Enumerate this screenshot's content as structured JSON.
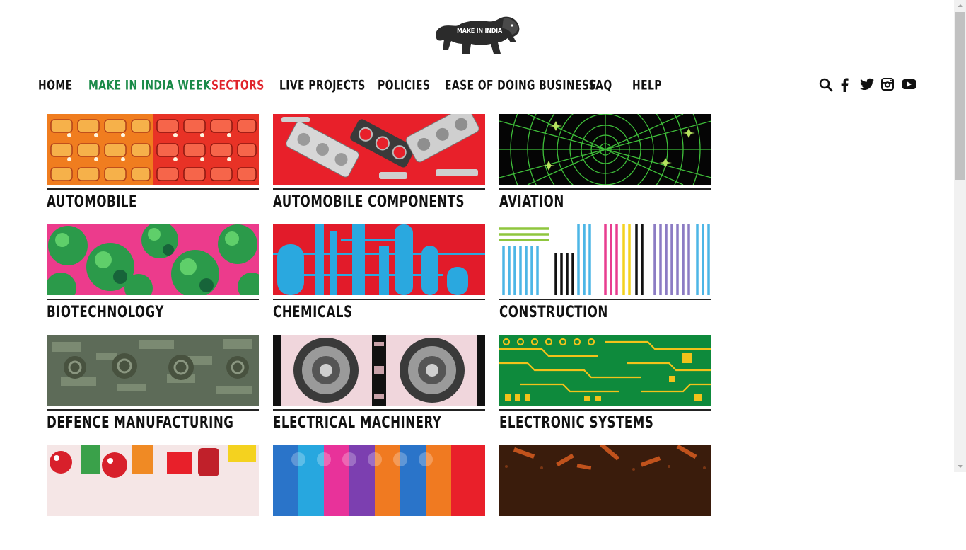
{
  "brand": {
    "logo_text": "MAKE IN INDIA",
    "colors": {
      "text": "#111111",
      "green": "#1a8a48",
      "red": "#e0242b"
    }
  },
  "nav": {
    "items": [
      {
        "label": "HOME",
        "state": "default"
      },
      {
        "label": "MAKE IN INDIA WEEK",
        "state": "highlight-green"
      },
      {
        "label": "SECTORS",
        "state": "active-red"
      },
      {
        "label": "LIVE PROJECTS",
        "state": "default"
      },
      {
        "label": "POLICIES",
        "state": "default"
      },
      {
        "label": "EASE OF DOING BUSINESS",
        "state": "default"
      },
      {
        "label": "FAQ",
        "state": "default"
      },
      {
        "label": "HELP",
        "state": "default"
      }
    ],
    "icons": [
      "search-icon",
      "facebook-icon",
      "twitter-icon",
      "instagram-icon",
      "youtube-icon"
    ]
  },
  "sectors": [
    {
      "label": "AUTOMOBILE",
      "theme": "orange-red"
    },
    {
      "label": "AUTOMOBILE COMPONENTS",
      "theme": "red-metal"
    },
    {
      "label": "AVIATION",
      "theme": "radar"
    },
    {
      "label": "BIOTECHNOLOGY",
      "theme": "green-pink"
    },
    {
      "label": "CHEMICALS",
      "theme": "blue-red"
    },
    {
      "label": "CONSTRUCTION",
      "theme": "stripes"
    },
    {
      "label": "DEFENCE MANUFACTURING",
      "theme": "camo"
    },
    {
      "label": "ELECTRICAL MACHINERY",
      "theme": "turbine"
    },
    {
      "label": "ELECTRONIC SYSTEMS",
      "theme": "circuit"
    },
    {
      "label": "",
      "theme": "food"
    },
    {
      "label": "",
      "theme": "rainbow"
    },
    {
      "label": "",
      "theme": "dark-texture"
    }
  ]
}
